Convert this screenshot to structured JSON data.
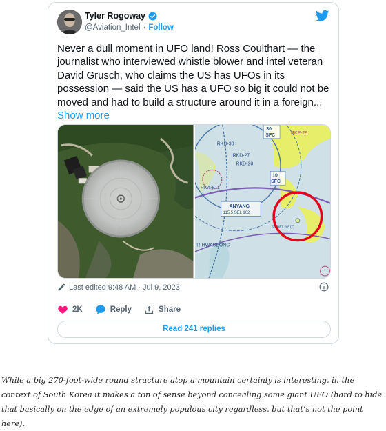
{
  "tweet": {
    "author_name": "Tyler Rogoway",
    "handle": "@Aviation_Intel",
    "separator": "·",
    "follow_label": "Follow",
    "text": "Never a dull moment in UFO land! Ross Coulthart — the journalist who interviewed whistle blower and intel veteran David Grusch, who claims the US has UFOs in its possession — said the US has a UFO so big it could not be moved and had to build a structure around it in a foreign...",
    "show_more_label": "Show more",
    "last_edited": "Last edited 9:48 AM · Jul 9, 2023",
    "like_count": "2K",
    "reply_label": "Reply",
    "share_label": "Share",
    "read_replies_label": "Read 241 replies"
  },
  "map_labels": {
    "sfc_30": "30",
    "sfc": "SFC",
    "rkd_30": "RKD-30",
    "rkd_27": "RKD-27",
    "rkd_28": "RKD-28",
    "rkp_29": "RKP-29",
    "rka_811": "RKA-811",
    "sfc_10": "10",
    "anyang": "ANYANG",
    "freq": "115.5 SEL 102",
    "hwaseong": "-R-HWASEONG",
    "sigmet": "SIGMET 205 (T)"
  },
  "caption": "While a big 270-foot-wide round structure atop a mountain certainly is interesting, in the context of South Korea it makes a ton of sense beyond concealing some giant UFO (hard to hide that basically on the edge of an extremely populous city regardless, but that’s not the point here).",
  "colors": {
    "twitter_blue": "#1d9bf0",
    "like_pink": "#f91880",
    "map_red": "#e3001b"
  }
}
